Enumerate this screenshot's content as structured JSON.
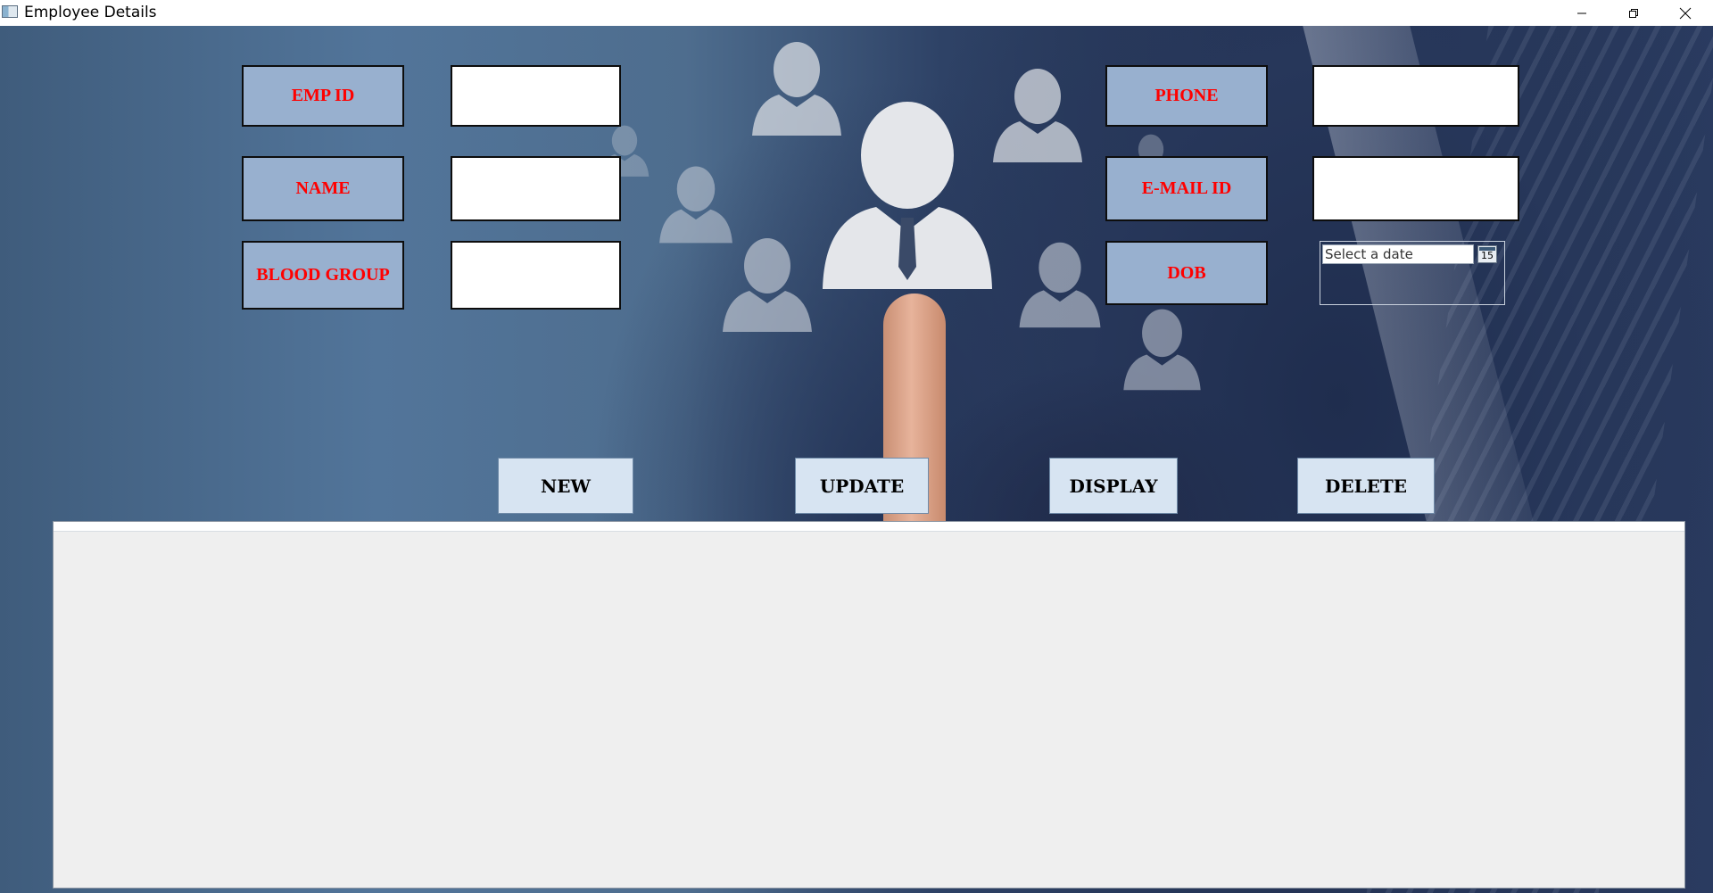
{
  "window": {
    "title": "Employee Details",
    "controls": {
      "minimize_icon": "minimize-icon",
      "maximize_icon": "restore-icon",
      "close_icon": "close-icon"
    }
  },
  "form": {
    "labels": {
      "emp_id": "EMP ID",
      "name": "NAME",
      "blood_group": "BLOOD GROUP",
      "phone": "PHONE",
      "email": "E-MAIL ID",
      "dob": "DOB"
    },
    "values": {
      "emp_id": "",
      "name": "",
      "blood_group": "",
      "phone": "",
      "email": ""
    },
    "dob_picker": {
      "placeholder": "Select a date",
      "calendar_day": "15",
      "icon": "calendar-icon"
    }
  },
  "actions": {
    "new": "NEW",
    "update": "UPDATE",
    "display": "DISPLAY",
    "delete": "DELETE"
  },
  "colors": {
    "label_bg": "#98b0cf",
    "label_text": "#ff0000",
    "button_bg": "#d7e4f2",
    "grid_bg": "#efefef"
  }
}
